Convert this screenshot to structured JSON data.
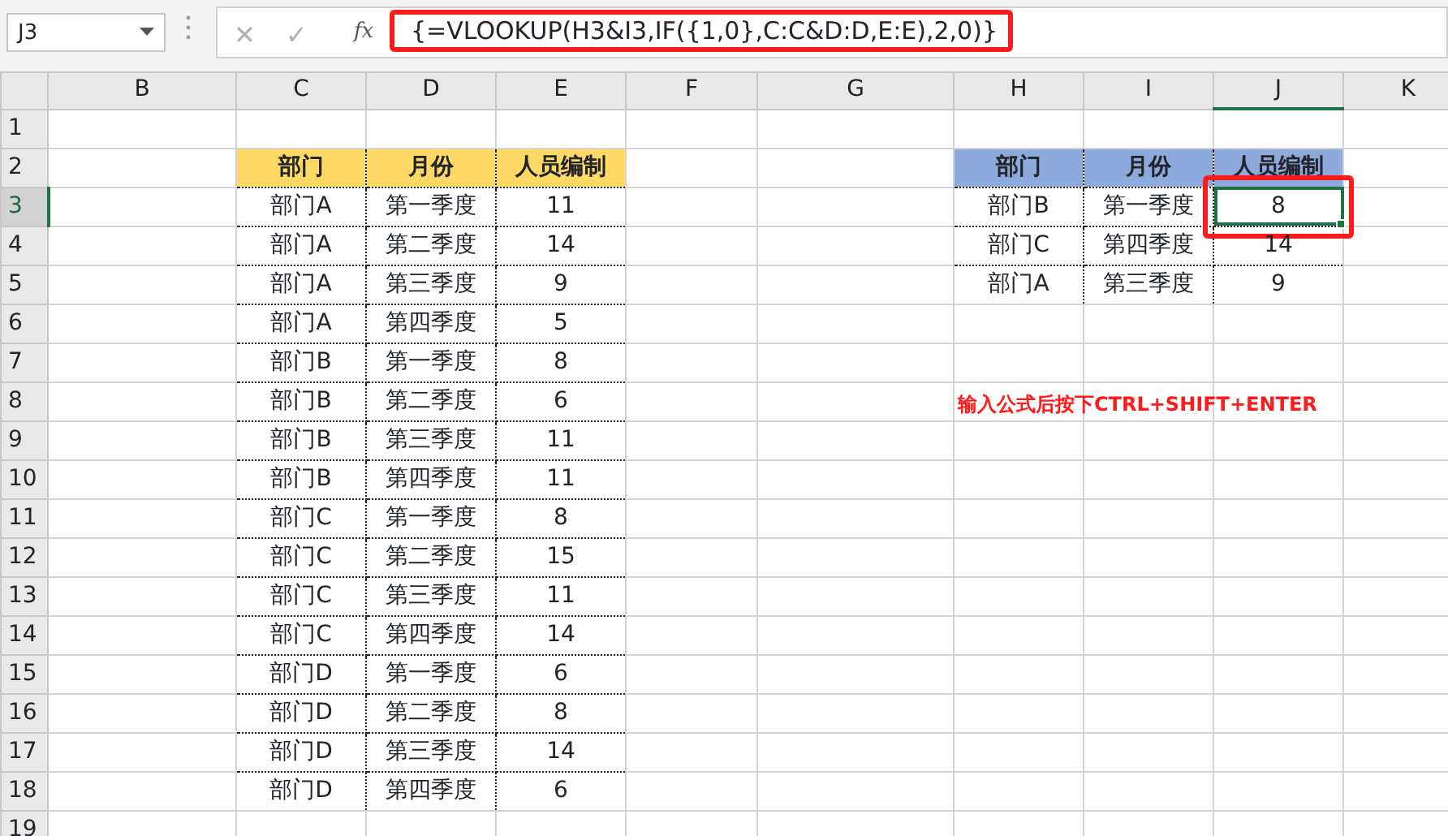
{
  "name_box": {
    "value": "J3"
  },
  "formula_bar": {
    "cancel": "✕",
    "enter": "✓",
    "fx": "fx",
    "formula": "{=VLOOKUP(H3&I3,IF({1,0},C:C&D:D,E:E),2,0)}"
  },
  "columns": [
    {
      "label": "B",
      "selected": false
    },
    {
      "label": "C",
      "selected": false
    },
    {
      "label": "D",
      "selected": false
    },
    {
      "label": "E",
      "selected": false
    },
    {
      "label": "F",
      "selected": false
    },
    {
      "label": "G",
      "selected": false
    },
    {
      "label": "H",
      "selected": false
    },
    {
      "label": "I",
      "selected": false
    },
    {
      "label": "J",
      "selected": true
    },
    {
      "label": "K",
      "selected": false
    }
  ],
  "rows": [
    {
      "label": "1",
      "selected": false
    },
    {
      "label": "2",
      "selected": false
    },
    {
      "label": "3",
      "selected": true
    },
    {
      "label": "4",
      "selected": false
    },
    {
      "label": "5",
      "selected": false
    },
    {
      "label": "6",
      "selected": false
    },
    {
      "label": "7",
      "selected": false
    },
    {
      "label": "8",
      "selected": false
    },
    {
      "label": "9",
      "selected": false
    },
    {
      "label": "10",
      "selected": false
    },
    {
      "label": "11",
      "selected": false
    },
    {
      "label": "12",
      "selected": false
    },
    {
      "label": "13",
      "selected": false
    },
    {
      "label": "14",
      "selected": false
    },
    {
      "label": "15",
      "selected": false
    },
    {
      "label": "16",
      "selected": false
    },
    {
      "label": "17",
      "selected": false
    },
    {
      "label": "18",
      "selected": false
    },
    {
      "label": "19",
      "selected": false
    }
  ],
  "tables": [
    {
      "color": "#ffd966",
      "header": [
        "部门",
        "月份",
        "人员编制"
      ],
      "rows": [
        [
          "部门A",
          "第一季度",
          "11"
        ],
        [
          "部门A",
          "第二季度",
          "14"
        ],
        [
          "部门A",
          "第三季度",
          "9"
        ],
        [
          "部门A",
          "第四季度",
          "5"
        ],
        [
          "部门B",
          "第一季度",
          "8"
        ],
        [
          "部门B",
          "第二季度",
          "6"
        ],
        [
          "部门B",
          "第三季度",
          "11"
        ],
        [
          "部门B",
          "第四季度",
          "11"
        ],
        [
          "部门C",
          "第一季度",
          "8"
        ],
        [
          "部门C",
          "第二季度",
          "15"
        ],
        [
          "部门C",
          "第三季度",
          "11"
        ],
        [
          "部门C",
          "第四季度",
          "14"
        ],
        [
          "部门D",
          "第一季度",
          "6"
        ],
        [
          "部门D",
          "第二季度",
          "8"
        ],
        [
          "部门D",
          "第三季度",
          "14"
        ],
        [
          "部门D",
          "第四季度",
          "6"
        ]
      ]
    },
    {
      "color": "#8ea9db",
      "header": [
        "部门",
        "月份",
        "人员编制"
      ],
      "rows": [
        [
          "部门B",
          "第一季度",
          "8"
        ],
        [
          "部门C",
          "第四季度",
          "14"
        ],
        [
          "部门A",
          "第三季度",
          "9"
        ]
      ]
    }
  ],
  "note": "输入公式后按下CTRL+SHIFT+ENTER"
}
